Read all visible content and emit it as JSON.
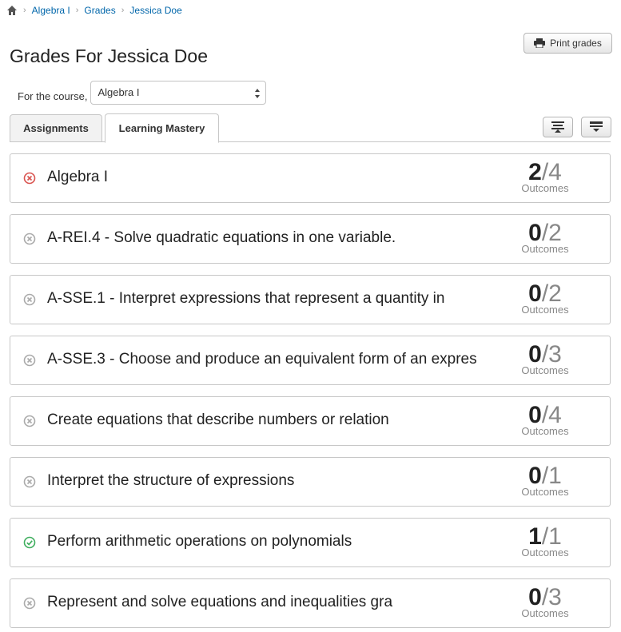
{
  "breadcrumb": {
    "home_icon": "home-icon",
    "items": [
      "Algebra I",
      "Grades",
      "Jessica Doe"
    ]
  },
  "print_button": {
    "label": "Print grades",
    "icon": "printer-icon"
  },
  "page_title": "Grades For Jessica Doe",
  "course_filter": {
    "label": "For the course,",
    "selected": "Algebra I"
  },
  "tabs": [
    {
      "label": "Assignments",
      "active": false
    },
    {
      "label": "Learning Mastery",
      "active": true
    }
  ],
  "toolbar": {
    "expand_icon": "expand-all-icon",
    "collapse_icon": "collapse-all-icon"
  },
  "colors": {
    "link": "#0066aa",
    "failed": "#d9534f",
    "passed": "#3fae5e",
    "neutral": "#aaaaaa"
  },
  "outcome_groups": [
    {
      "title": "Algebra I",
      "mastered": "2",
      "total": "/4",
      "label": "Outcomes",
      "status": "failed"
    },
    {
      "title": "A-REI.4 - Solve quadratic equations in one variable.",
      "mastered": "0",
      "total": "/2",
      "label": "Outcomes",
      "status": "neutral"
    },
    {
      "title": "A-SSE.1 - Interpret expressions that represent a quantity in",
      "mastered": "0",
      "total": "/2",
      "label": "Outcomes",
      "status": "neutral"
    },
    {
      "title": "A-SSE.3 - Choose and produce an equivalent form of an expres",
      "mastered": "0",
      "total": "/3",
      "label": "Outcomes",
      "status": "neutral"
    },
    {
      "title": "Create equations that describe numbers or relation",
      "mastered": "0",
      "total": "/4",
      "label": "Outcomes",
      "status": "neutral"
    },
    {
      "title": "Interpret the structure of expressions",
      "mastered": "0",
      "total": "/1",
      "label": "Outcomes",
      "status": "neutral"
    },
    {
      "title": "Perform arithmetic operations on polynomials",
      "mastered": "1",
      "total": "/1",
      "label": "Outcomes",
      "status": "passed"
    },
    {
      "title": "Represent and solve equations and inequalities gra",
      "mastered": "0",
      "total": "/3",
      "label": "Outcomes",
      "status": "neutral"
    }
  ]
}
